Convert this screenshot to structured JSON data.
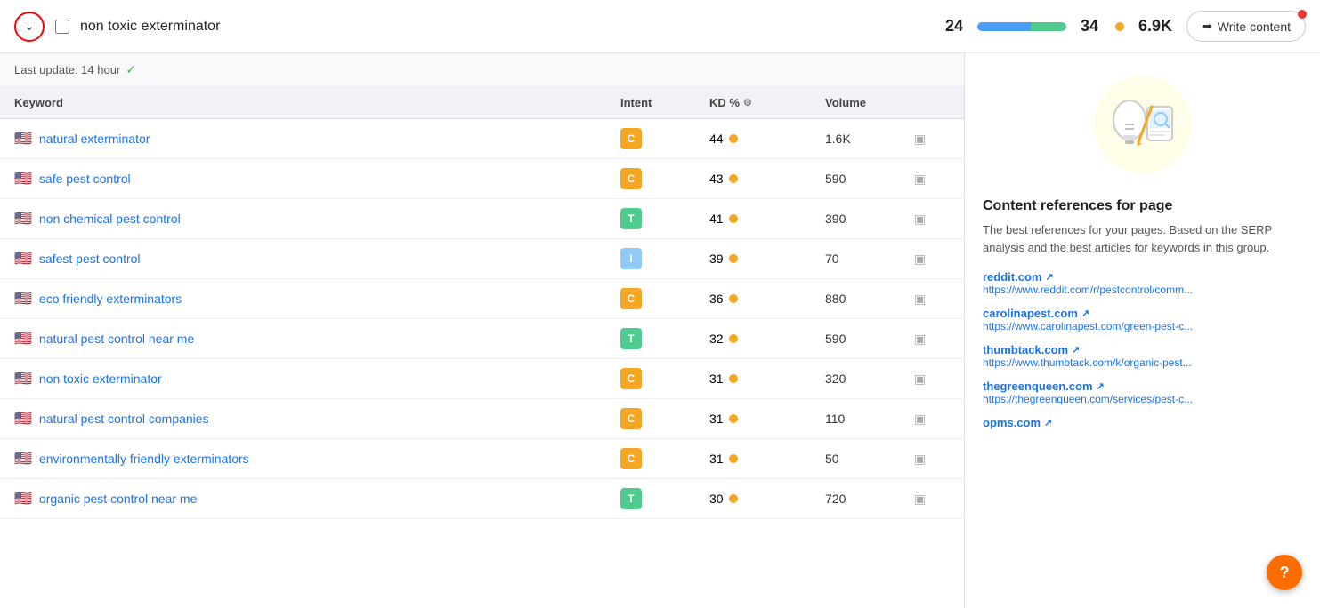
{
  "topbar": {
    "keyword": "non toxic exterminator",
    "score1": "24",
    "score2": "34",
    "volume": "6.9K",
    "write_label": "Write content",
    "last_update": "Last update: 14 hour"
  },
  "table": {
    "headers": {
      "keyword": "Keyword",
      "intent": "Intent",
      "kd": "KD %",
      "volume": "Volume"
    },
    "rows": [
      {
        "flag": "🇺🇸",
        "keyword": "natural exterminator",
        "intent": "C",
        "intent_type": "c",
        "kd": "44",
        "dot": "orange",
        "volume": "1.6K"
      },
      {
        "flag": "🇺🇸",
        "keyword": "safe pest control",
        "intent": "C",
        "intent_type": "c",
        "kd": "43",
        "dot": "orange",
        "volume": "590"
      },
      {
        "flag": "🇺🇸",
        "keyword": "non chemical pest control",
        "intent": "T",
        "intent_type": "t",
        "kd": "41",
        "dot": "orange",
        "volume": "390"
      },
      {
        "flag": "🇺🇸",
        "keyword": "safest pest control",
        "intent": "I",
        "intent_type": "i",
        "kd": "39",
        "dot": "orange",
        "volume": "70"
      },
      {
        "flag": "🇺🇸",
        "keyword": "eco friendly exterminators",
        "intent": "C",
        "intent_type": "c",
        "kd": "36",
        "dot": "orange",
        "volume": "880"
      },
      {
        "flag": "🇺🇸",
        "keyword": "natural pest control near me",
        "intent": "T",
        "intent_type": "t",
        "kd": "32",
        "dot": "orange",
        "volume": "590"
      },
      {
        "flag": "🇺🇸",
        "keyword": "non toxic exterminator",
        "intent": "C",
        "intent_type": "c",
        "kd": "31",
        "dot": "orange",
        "volume": "320"
      },
      {
        "flag": "🇺🇸",
        "keyword": "natural pest control companies",
        "intent": "C",
        "intent_type": "c",
        "kd": "31",
        "dot": "orange",
        "volume": "110"
      },
      {
        "flag": "🇺🇸",
        "keyword": "environmentally friendly exterminators",
        "intent": "C",
        "intent_type": "c",
        "kd": "31",
        "dot": "orange",
        "volume": "50"
      },
      {
        "flag": "🇺🇸",
        "keyword": "organic pest control near me",
        "intent": "T",
        "intent_type": "t",
        "kd": "30",
        "dot": "orange",
        "volume": "720"
      }
    ]
  },
  "right_panel": {
    "title": "Content references for page",
    "description": "The best references for your pages. Based on the SERP analysis and the best articles for keywords in this group.",
    "refs": [
      {
        "domain": "reddit.com",
        "url": "https://www.reddit.com/r/pestcontrol/comm..."
      },
      {
        "domain": "carolinapest.com",
        "url": "https://www.carolinapest.com/green-pest-c..."
      },
      {
        "domain": "thumbtack.com",
        "url": "https://www.thumbtack.com/k/organic-pest..."
      },
      {
        "domain": "thegreenqueen.com",
        "url": "https://thegreenqueen.com/services/pest-c..."
      },
      {
        "domain": "opms.com",
        "url": ""
      }
    ]
  }
}
